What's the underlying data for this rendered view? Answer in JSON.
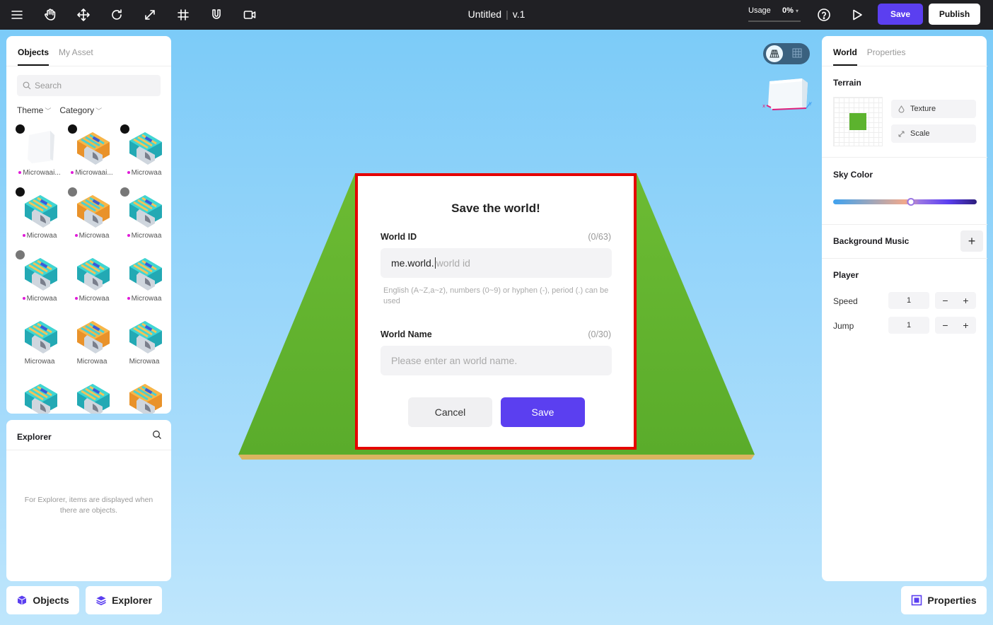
{
  "toolbar": {
    "doc_title": "Untitled",
    "version": "v.1",
    "usage_label": "Usage",
    "usage_value": "0%",
    "save_label": "Save",
    "publish_label": "Publish"
  },
  "objects_panel": {
    "tabs": [
      "Objects",
      "My Asset"
    ],
    "search_placeholder": "Search",
    "filters": [
      "Theme",
      "Category"
    ],
    "items": [
      {
        "name": "Microwaai...",
        "badge": "dark",
        "dot": true,
        "style": "white"
      },
      {
        "name": "Microwaai...",
        "badge": "dark",
        "dot": true,
        "style": "orange"
      },
      {
        "name": "Microwaa",
        "badge": "dark",
        "dot": true,
        "style": "teal"
      },
      {
        "name": "Microwaa",
        "badge": "dark",
        "dot": true,
        "style": "teal"
      },
      {
        "name": "Microwaa",
        "badge": "gray",
        "dot": true,
        "style": "orange"
      },
      {
        "name": "Microwaa",
        "badge": "gray",
        "dot": true,
        "style": "teal"
      },
      {
        "name": "Microwaa",
        "badge": "gray",
        "dot": true,
        "style": "teal"
      },
      {
        "name": "Microwaa",
        "badge": "",
        "dot": true,
        "style": "teal"
      },
      {
        "name": "Microwaa",
        "badge": "",
        "dot": true,
        "style": "teal"
      },
      {
        "name": "Microwaa",
        "badge": "",
        "dot": false,
        "style": "teal"
      },
      {
        "name": "Microwaa",
        "badge": "",
        "dot": false,
        "style": "orange"
      },
      {
        "name": "Microwaa",
        "badge": "",
        "dot": false,
        "style": "teal"
      },
      {
        "name": "",
        "badge": "",
        "dot": false,
        "style": "teal"
      },
      {
        "name": "",
        "badge": "",
        "dot": false,
        "style": "teal"
      },
      {
        "name": "",
        "badge": "",
        "dot": false,
        "style": "orange"
      }
    ]
  },
  "explorer_panel": {
    "title": "Explorer",
    "empty_text": "For Explorer, items are displayed when there are objects."
  },
  "bottom_buttons": {
    "objects": "Objects",
    "explorer": "Explorer",
    "properties": "Properties"
  },
  "right_panel": {
    "tabs": [
      "World",
      "Properties"
    ],
    "terrain_title": "Terrain",
    "texture_label": "Texture",
    "scale_label": "Scale",
    "sky_color_title": "Sky Color",
    "sky_value": 0.54,
    "bgm_title": "Background Music",
    "player_title": "Player",
    "speed_label": "Speed",
    "speed_value": "1",
    "jump_label": "Jump",
    "jump_value": "1"
  },
  "modal": {
    "title": "Save the world!",
    "world_id_label": "World ID",
    "world_id_count": "(0/63)",
    "world_id_prefix": "me.world.",
    "world_id_placeholder": "world id",
    "world_id_hint": "English (A~Z,a~z), numbers (0~9) or hyphen (-), period (.) can be used",
    "world_name_label": "World Name",
    "world_name_count": "(0/30)",
    "world_name_placeholder": "Please enter an world name.",
    "cancel_label": "Cancel",
    "save_label": "Save"
  },
  "colors": {
    "accent": "#5b3ff0",
    "terrain_green": "#5cb32e",
    "highlight_border": "#e50000"
  }
}
